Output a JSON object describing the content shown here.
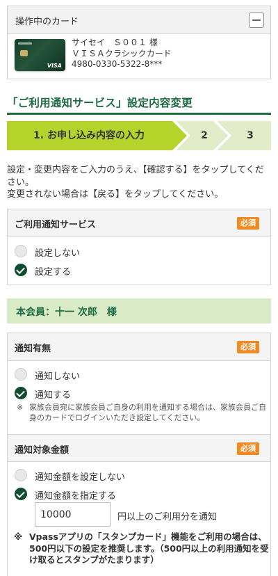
{
  "card_panel": {
    "title": "操作中のカード",
    "collapse_icon": "minus-icon",
    "card_brand": "VISA",
    "holder_line": "サイセイ　Ｓ００１ 様",
    "card_name": "ＶＩＳＡクラシックカード",
    "card_number": "4980-0330-5322-8***"
  },
  "page": {
    "title": "「ご利用通知サービス」設定内容変更"
  },
  "steps": {
    "active_color": "#b6d32b",
    "inactive_color": "#e3ecc9",
    "items": [
      {
        "label": "1. お申し込み内容の入力"
      },
      {
        "label": "2"
      },
      {
        "label": "3"
      }
    ]
  },
  "instruction": {
    "line1": "設定・変更内容をご入力のうえ、【確認する】をタップしてください。",
    "line2": "変更されない場合は【戻る】をタップしてください。"
  },
  "service": {
    "heading": "ご利用通知サービス",
    "required": "必須",
    "options": [
      "設定しない",
      "設定する"
    ],
    "selected_index": 1
  },
  "member": {
    "label": "本会員：十一 次郎　様"
  },
  "notify": {
    "heading": "通知有無",
    "required": "必須",
    "options": [
      "通知しない",
      "通知する"
    ],
    "selected_index": 1,
    "note_mark": "※",
    "note": "家族会員宛に家族会員ご自身の利用を通知する場合は、家族会員ご自身のカードでログインいただき設定してください。"
  },
  "amount": {
    "heading": "通知対象金額",
    "required": "必須",
    "options": [
      "通知金額を設定しない",
      "通知金額を指定する"
    ],
    "selected_index": 1,
    "value": "10000",
    "suffix": "円以上のご利用分を通知"
  },
  "vpass_note": {
    "mark": "※",
    "text": "Vpassアプリの「スタンプカード」機能をご利用の場合は、500円以下の設定を推奨します。（500円以上の利用通知を受け取るとスタンプがたまります）"
  },
  "colors": {
    "brand_green": "#1e6b43",
    "radio_checked": "#0f4d30",
    "required_badge": "#f08a25",
    "member_bar": "#d9ebc6"
  }
}
